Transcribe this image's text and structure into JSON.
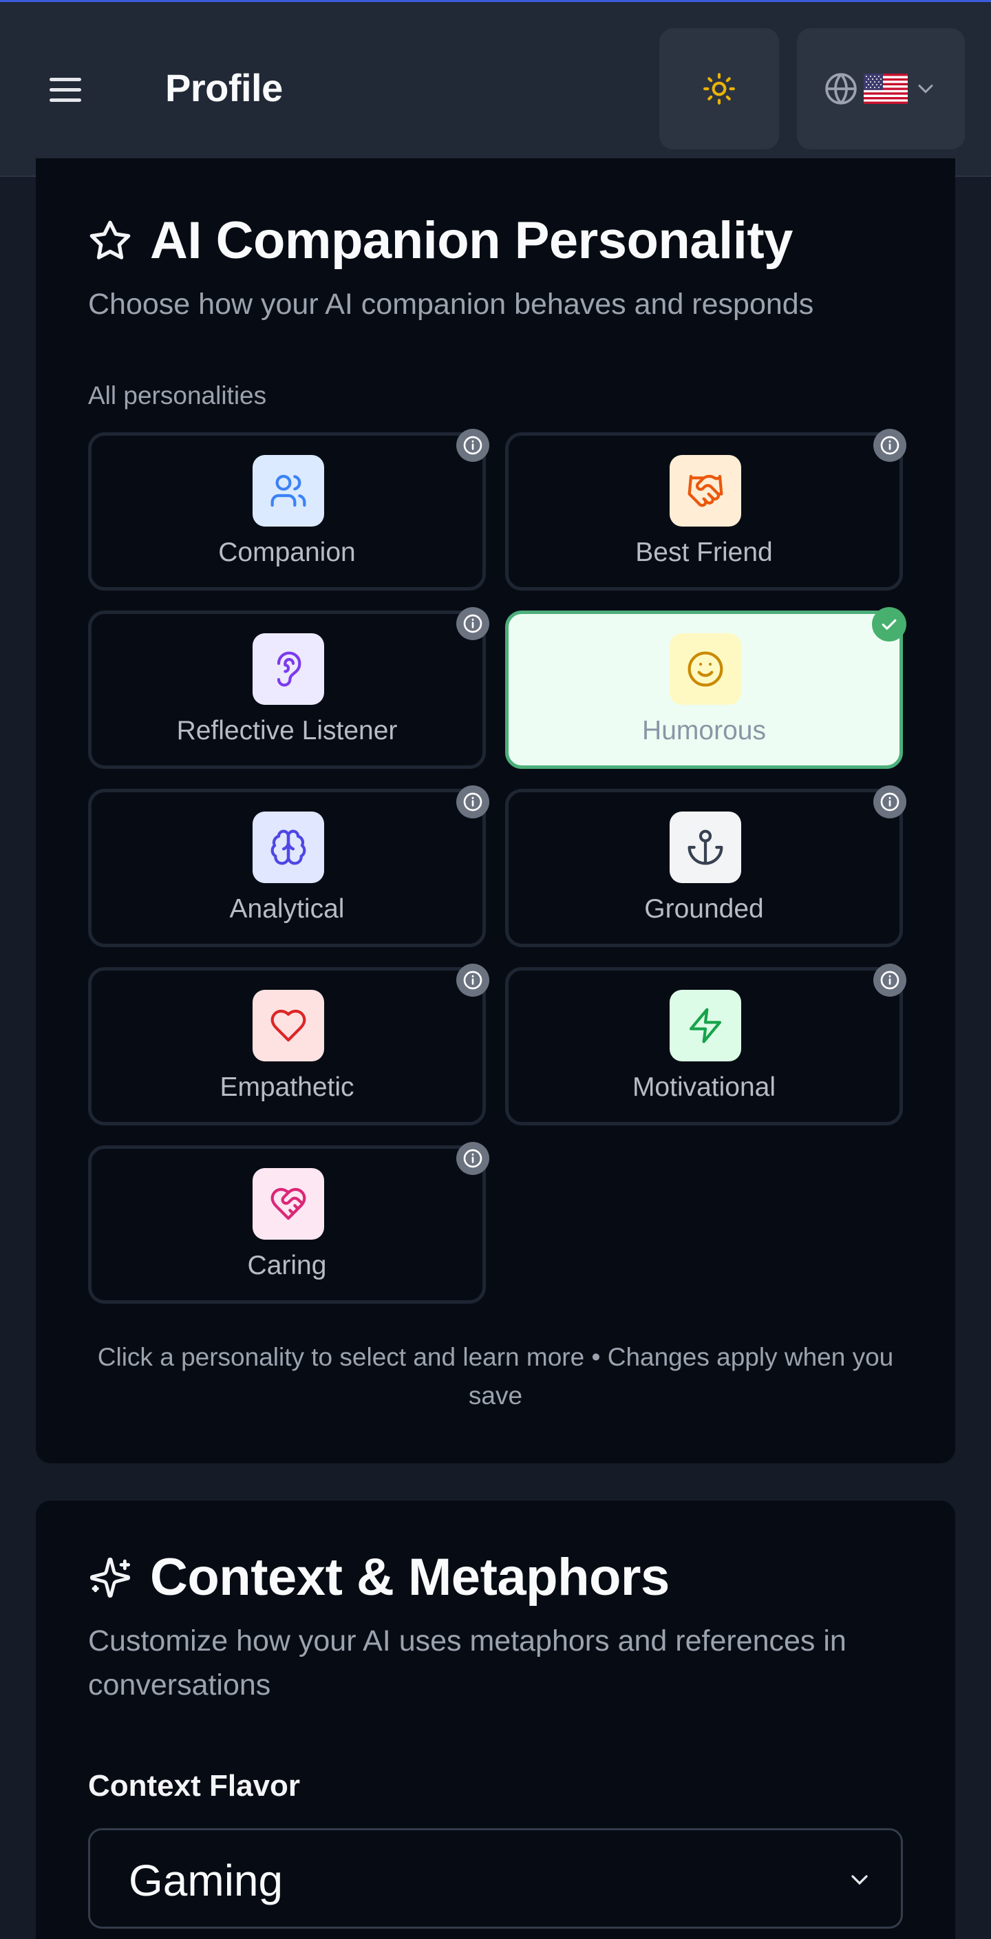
{
  "header": {
    "title": "Profile",
    "theme_icon": "sun-icon",
    "language_icon": "globe-icon",
    "flag": "us-flag"
  },
  "personality": {
    "title": "AI Companion Personality",
    "subtitle": "Choose how your AI companion behaves and responds",
    "list_label": "All personalities",
    "selected": "Humorous",
    "items": [
      {
        "label": "Companion",
        "icon": "users-icon",
        "bg": "#dbeafe",
        "color": "#3b82f6"
      },
      {
        "label": "Best Friend",
        "icon": "handshake-icon",
        "bg": "#ffedd5",
        "color": "#ea580c"
      },
      {
        "label": "Reflective Listener",
        "icon": "ear-icon",
        "bg": "#ede9fe",
        "color": "#7c3aed"
      },
      {
        "label": "Humorous",
        "icon": "smile-icon",
        "bg": "#fef9c3",
        "color": "#ca8a04"
      },
      {
        "label": "Analytical",
        "icon": "brain-icon",
        "bg": "#e0e7ff",
        "color": "#4f46e5"
      },
      {
        "label": "Grounded",
        "icon": "anchor-icon",
        "bg": "#f3f4f6",
        "color": "#374151"
      },
      {
        "label": "Empathetic",
        "icon": "heart-icon",
        "bg": "#fee2e2",
        "color": "#dc2626"
      },
      {
        "label": "Motivational",
        "icon": "zap-icon",
        "bg": "#dcfce7",
        "color": "#16a34a"
      },
      {
        "label": "Caring",
        "icon": "heart-handshake-icon",
        "bg": "#fce7f3",
        "color": "#db2777"
      }
    ],
    "hint": "Click a personality to select and learn more • Changes apply when you save"
  },
  "context": {
    "title": "Context & Metaphors",
    "subtitle": "Customize how your AI uses metaphors and references in conversations",
    "field_label": "Context Flavor",
    "selected_value": "Gaming"
  },
  "colors": {
    "selected_border": "#4caf7a",
    "selected_bg": "#eefdf3",
    "check_badge": "#47b06f",
    "sun": "#eab308"
  }
}
